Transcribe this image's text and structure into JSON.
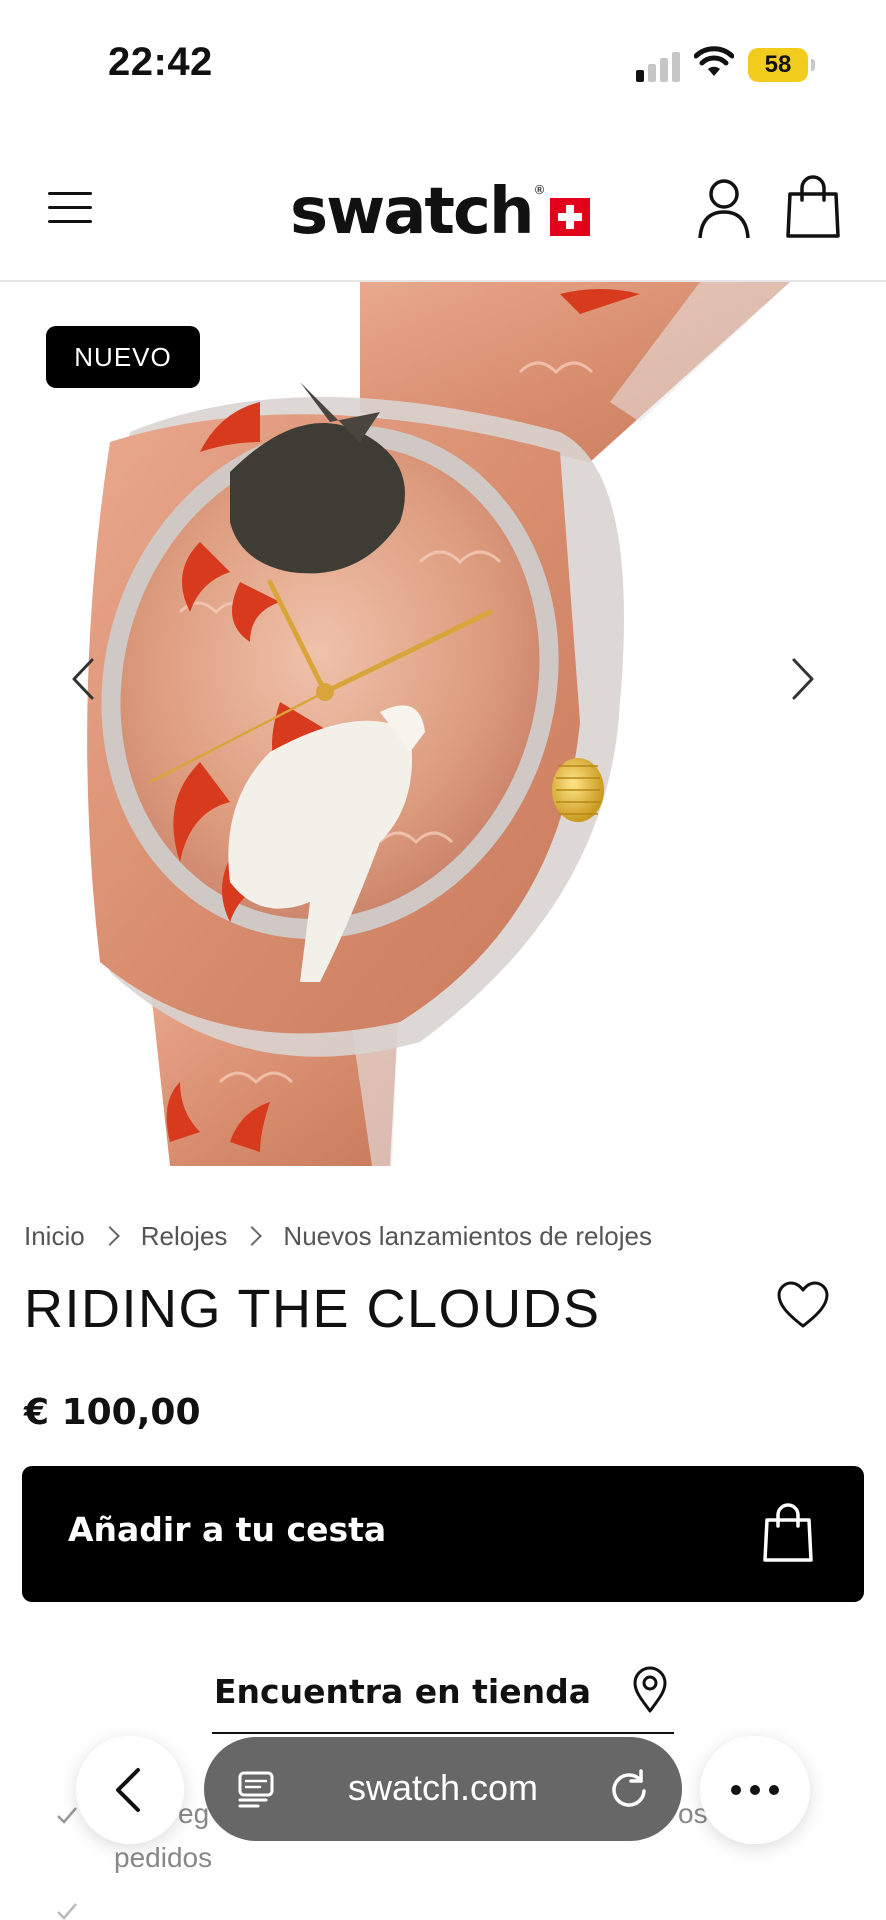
{
  "status_bar": {
    "time": "22:42",
    "battery": "58",
    "signal_bars_active": 1,
    "signal_bars_total": 4
  },
  "header": {
    "logo": "swatch",
    "menu_icon": "hamburger-menu-icon",
    "account_icon": "user-icon",
    "bag_icon": "shopping-bag-icon"
  },
  "gallery": {
    "badge": "NUEVO",
    "prev_icon": "chevron-left-icon",
    "next_icon": "chevron-right-icon"
  },
  "breadcrumb": {
    "items": [
      "Inicio",
      "Relojes",
      "Nuevos lanzamientos de relojes"
    ]
  },
  "product": {
    "title": "RIDING THE CLOUDS",
    "price": "€ 100,00",
    "wishlist_icon": "heart-icon"
  },
  "actions": {
    "add_to_cart": "Añadir a tu cesta",
    "find_in_store": "Encuentra en tienda"
  },
  "benefits": {
    "line1_left": "eg",
    "line1_right": "os",
    "line2": "pedidos"
  },
  "browser": {
    "url": "swatch.com",
    "back_icon": "chevron-left-icon",
    "reader_icon": "reader-icon",
    "reload_icon": "reload-icon",
    "more_icon": "more-icon"
  },
  "colors": {
    "accent": "#000000",
    "swiss_red": "#e3001b",
    "battery": "#f2cc1d",
    "strap": "#d98e70"
  }
}
